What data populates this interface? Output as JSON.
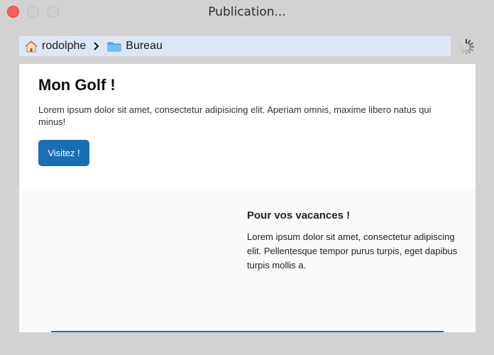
{
  "window": {
    "title": "Publication..."
  },
  "pathbar": {
    "items": [
      {
        "label": "rodolphe",
        "icon": "home-icon"
      },
      {
        "label": "Bureau",
        "icon": "folder-icon"
      }
    ],
    "separator_icon": "chevron-right-icon",
    "activity_icon": "spinner-icon"
  },
  "page": {
    "heading": "Mon Golf !",
    "lead": "Lorem ipsum dolor sit amet, consectetur adipisicing elit. Aperiam omnis, maxime libero natus qui minus!",
    "button_label": "Visitez !",
    "section": {
      "title": "Pour vos vacances !",
      "body": "Lorem ipsum dolor sit amet, consectetur adipiscing elit. Pellentesque tempor purus turpis, eget dapibus turpis mollis a."
    }
  },
  "colors": {
    "close": "#fc5f57",
    "pathbar_bg": "#dde6f4",
    "button": "#1a6fb4",
    "folder": "#5aabe8"
  }
}
